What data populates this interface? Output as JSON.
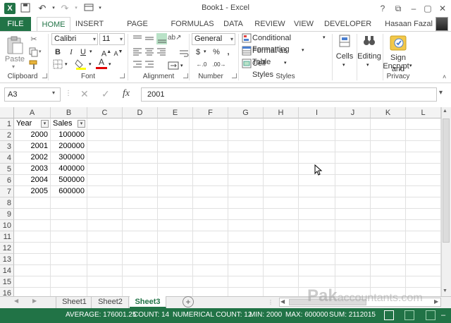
{
  "title_bar": {
    "title": "Book1 - Excel",
    "qat": [
      "excel-logo",
      "save-icon",
      "undo-icon",
      "redo-icon",
      "customize-icon"
    ],
    "window_buttons": [
      "?",
      "⧉",
      "–",
      "▢",
      "✕"
    ]
  },
  "tabs": {
    "file": "FILE",
    "items": [
      "HOME",
      "INSERT",
      "PAGE LAYOUT",
      "FORMULAS",
      "DATA",
      "REVIEW",
      "VIEW",
      "DEVELOPER"
    ],
    "user": "Hasaan Fazal"
  },
  "ribbon": {
    "clipboard": {
      "label": "Clipboard",
      "paste": "Paste"
    },
    "font": {
      "label": "Font",
      "name": "Calibri",
      "size": "11",
      "bold": "B",
      "italic": "I",
      "underline": "U"
    },
    "alignment": {
      "label": "Alignment"
    },
    "number": {
      "label": "Number",
      "format": "General",
      "currency": "$",
      "percent": "%",
      "comma": ","
    },
    "styles": {
      "label": "Styles",
      "conditional": "Conditional Formatting",
      "format_table": "Format as Table",
      "cell_styles": "Cell Styles"
    },
    "cells": {
      "label": "Cells"
    },
    "editing": {
      "label": "Editing"
    },
    "privacy": {
      "label": "Privacy",
      "sign1": "Sign and",
      "sign2": "Encrypt"
    }
  },
  "formula_bar": {
    "name_box": "A3",
    "fx": "fx",
    "value": "2001"
  },
  "columns": [
    "A",
    "B",
    "C",
    "D",
    "E",
    "F",
    "G",
    "H",
    "I",
    "J",
    "K",
    "L"
  ],
  "rows": [
    "1",
    "2",
    "3",
    "4",
    "5",
    "6",
    "7",
    "8",
    "9",
    "10",
    "11",
    "12",
    "13",
    "14",
    "15",
    "16"
  ],
  "table": {
    "headers": [
      "Year",
      "Sales"
    ],
    "data": [
      [
        "2000",
        "100000"
      ],
      [
        "2001",
        "200000"
      ],
      [
        "2002",
        "300000"
      ],
      [
        "2003",
        "400000"
      ],
      [
        "2004",
        "500000"
      ],
      [
        "2005",
        "600000"
      ]
    ]
  },
  "sheets": [
    "Sheet1",
    "Sheet2",
    "Sheet3"
  ],
  "active_sheet": "Sheet3",
  "watermark": "Pakaccountants.com",
  "status_bar": {
    "average": "AVERAGE: 176001.25",
    "count": "COUNT: 14",
    "numerical_count": "NUMERICAL COUNT: 12",
    "min": "MIN: 2000",
    "max": "MAX: 600000",
    "sum": "SUM: 2112015"
  },
  "colors": {
    "accent": "#217346",
    "statusbar": "#217346"
  }
}
